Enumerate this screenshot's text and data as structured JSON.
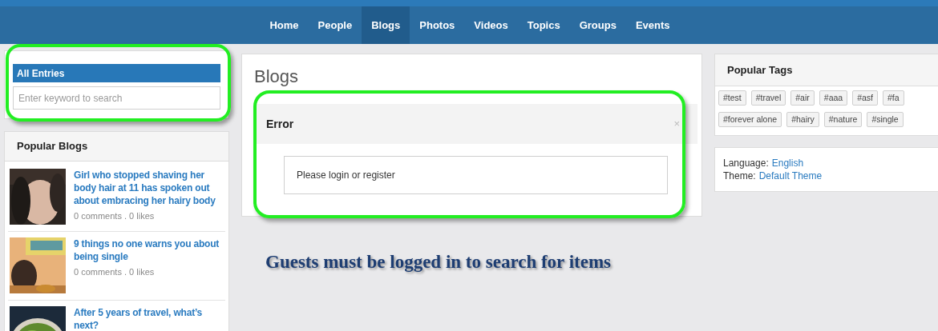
{
  "nav": {
    "items": [
      {
        "label": "Home",
        "selected": false
      },
      {
        "label": "People",
        "selected": false
      },
      {
        "label": "Blogs",
        "selected": true
      },
      {
        "label": "Photos",
        "selected": false
      },
      {
        "label": "Videos",
        "selected": false
      },
      {
        "label": "Topics",
        "selected": false
      },
      {
        "label": "Groups",
        "selected": false
      },
      {
        "label": "Events",
        "selected": false
      }
    ]
  },
  "search": {
    "title": "All Entries",
    "placeholder": "Enter keyword to search"
  },
  "popular_blogs": {
    "title": "Popular Blogs",
    "items": [
      {
        "title": "Girl who stopped shaving her body hair at 11 has spoken out about embracing her hairy body",
        "meta": "0 comments . 0 likes",
        "kind": "picture"
      },
      {
        "title": "9 things no one warns you about being single",
        "meta": "0 comments . 0 likes",
        "kind": "picture"
      },
      {
        "title": "After 5 years of travel, what’s next?",
        "kind": "picture"
      }
    ]
  },
  "main": {
    "title": "Blogs",
    "error": {
      "title": "Error",
      "close": "×",
      "message": "Please login or register"
    }
  },
  "popular_tags": {
    "title": "Popular Tags",
    "tags": [
      "#test",
      "#travel",
      "#air",
      "#aaa",
      "#asf",
      "#fa",
      "#forever alone",
      "#hairy",
      "#nature",
      "#single"
    ]
  },
  "settings": [
    {
      "label": "Language:",
      "value": "English"
    },
    {
      "label": "Theme:",
      "value": "Default Theme"
    }
  ],
  "annotation": {
    "caption": "Guests must be logged in to search for items"
  }
}
